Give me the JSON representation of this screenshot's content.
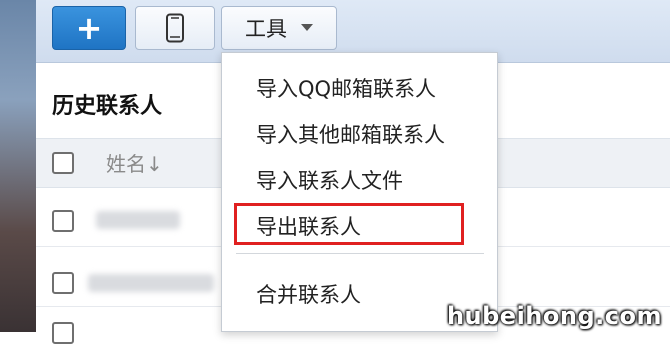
{
  "toolbar": {
    "add_label": "+",
    "add_icon": "plus-icon",
    "phone_icon": "mobile-phone-icon",
    "tools_label": "工具",
    "tools_icon": "caret-down-icon"
  },
  "section_title": "历史联系人",
  "table": {
    "name_column": "姓名↓"
  },
  "menu": {
    "items": [
      "导入QQ邮箱联系人",
      "导入其他邮箱联系人",
      "导入联系人文件",
      "导出联系人",
      "合并联系人"
    ],
    "highlighted_item": "导出联系人",
    "highlight_color": "#e02020"
  },
  "colors": {
    "primary_button": "#2a86d6",
    "toolbar_bg": "#d8e4f3"
  },
  "watermark": "hubeihong.com"
}
